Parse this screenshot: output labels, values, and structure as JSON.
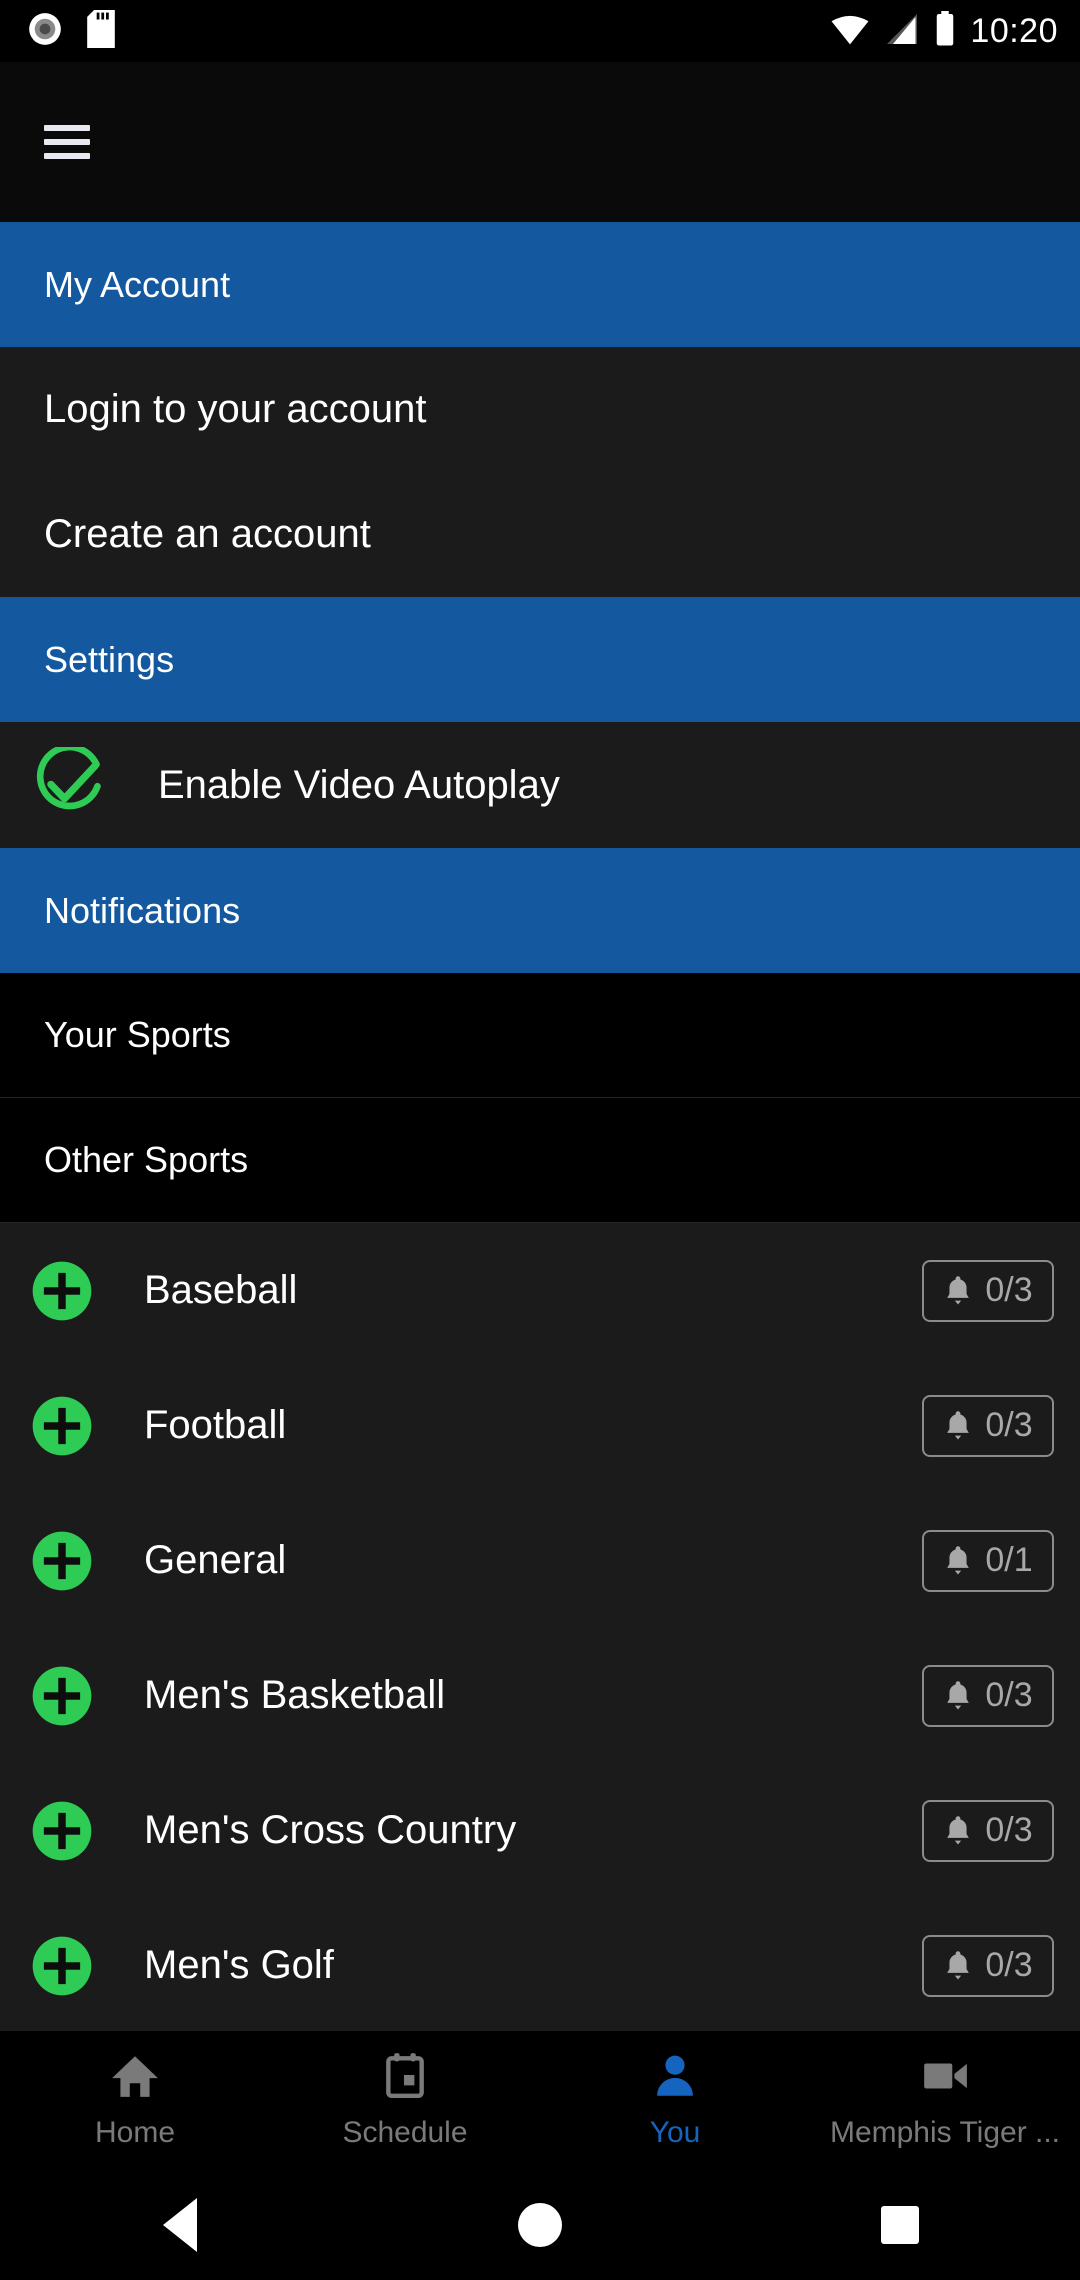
{
  "status_bar": {
    "icons": [
      "screen-record-icon",
      "sd-card-icon",
      "wifi-icon",
      "cellular-signal-icon",
      "battery-icon"
    ],
    "clock": "10:20"
  },
  "app_bar": {
    "menu_icon": "hamburger-menu-icon"
  },
  "colors": {
    "section_blue": "#14599f",
    "accent_green": "#2ecc55",
    "row_dark": "#1b1b1b",
    "pure_black": "#000000",
    "active_nav_blue": "#1565c0",
    "badge_gray": "#a8a8a8"
  },
  "sections": {
    "my_account": {
      "title": "My Account",
      "items": [
        {
          "label": "Login to your account"
        },
        {
          "label": "Create an account"
        }
      ]
    },
    "settings": {
      "title": "Settings",
      "items": [
        {
          "label": "Enable Video Autoplay",
          "icon": "check-circle-icon",
          "checked": true
        }
      ]
    },
    "notifications": {
      "title": "Notifications",
      "groups": [
        {
          "label": "Your Sports"
        },
        {
          "label": "Other Sports"
        }
      ],
      "sports": [
        {
          "name": "Baseball",
          "add_icon": "plus-circle-icon",
          "bell_icon": "bell-icon",
          "count": "0/3"
        },
        {
          "name": "Football",
          "add_icon": "plus-circle-icon",
          "bell_icon": "bell-icon",
          "count": "0/3"
        },
        {
          "name": "General",
          "add_icon": "plus-circle-icon",
          "bell_icon": "bell-icon",
          "count": "0/1"
        },
        {
          "name": "Men's Basketball",
          "add_icon": "plus-circle-icon",
          "bell_icon": "bell-icon",
          "count": "0/3"
        },
        {
          "name": "Men's Cross Country",
          "add_icon": "plus-circle-icon",
          "bell_icon": "bell-icon",
          "count": "0/3"
        },
        {
          "name": "Men's Golf",
          "add_icon": "plus-circle-icon",
          "bell_icon": "bell-icon",
          "count": "0/3"
        }
      ]
    }
  },
  "bottom_nav": {
    "items": [
      {
        "label": "Home",
        "icon": "home-icon",
        "active": false
      },
      {
        "label": "Schedule",
        "icon": "calendar-icon",
        "active": false
      },
      {
        "label": "You",
        "icon": "person-icon",
        "active": true
      },
      {
        "label": "Memphis Tiger ...",
        "icon": "video-camera-icon",
        "active": false
      }
    ]
  },
  "system_nav": {
    "back": "back-triangle-icon",
    "home": "home-circle-icon",
    "recents": "recents-square-icon"
  }
}
